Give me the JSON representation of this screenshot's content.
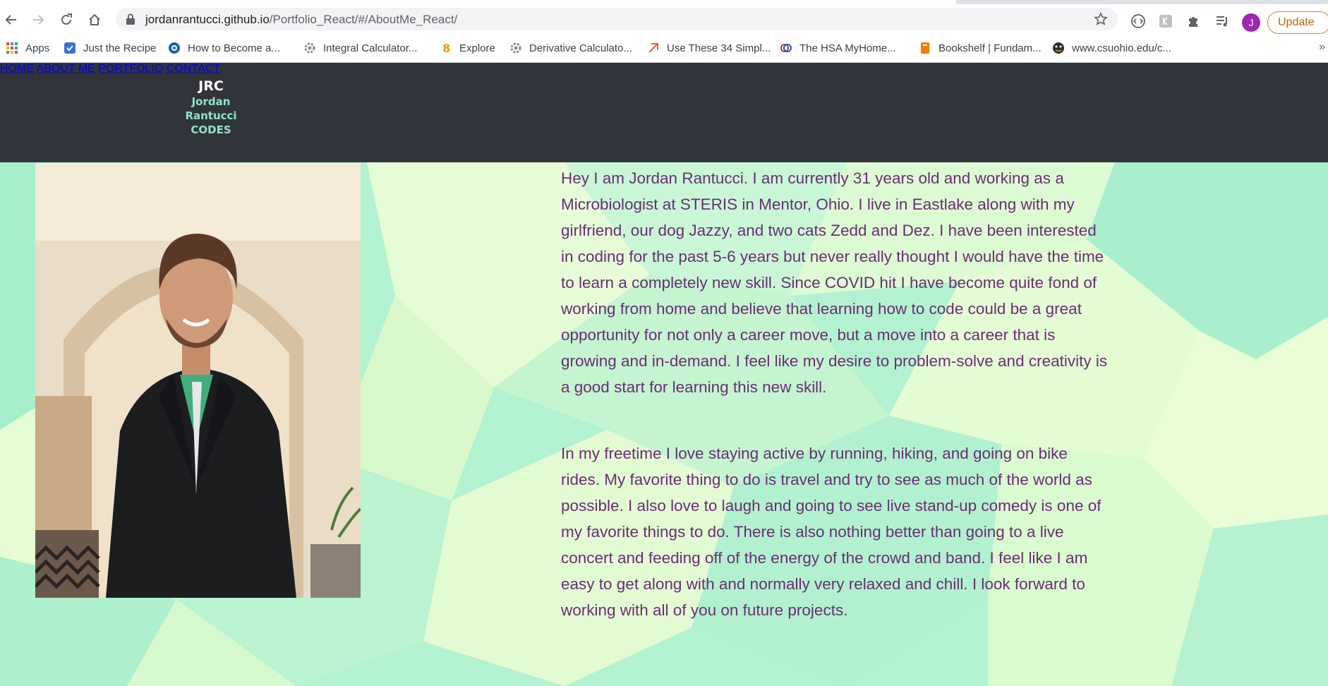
{
  "browser": {
    "url_host": "jordanrantucci.github.io",
    "url_path": "/Portfolio_React/#/AboutMe_React/",
    "profile_initial": "J",
    "update_label": "Update"
  },
  "bookmarks": [
    {
      "label": "Apps",
      "icon": "apps-grid-icon"
    },
    {
      "label": "Just the Recipe",
      "icon": "recipe-icon"
    },
    {
      "label": "How to Become a...",
      "icon": "globe-icon"
    },
    {
      "label": "Integral Calculator...",
      "icon": "gear-icon"
    },
    {
      "label": "Explore",
      "icon": "explore-icon"
    },
    {
      "label": "Derivative Calculato...",
      "icon": "gear-icon"
    },
    {
      "label": "Use These 34 Simpl...",
      "icon": "link-icon"
    },
    {
      "label": "The HSA MyHome...",
      "icon": "hsa-icon"
    },
    {
      "label": "Bookshelf | Fundam...",
      "icon": "bookshelf-icon"
    },
    {
      "label": "www.csuohio.edu/c...",
      "icon": "csu-icon"
    }
  ],
  "site": {
    "logo": {
      "line1": "JRC",
      "line2": "Jordan",
      "line3": "Rantucci",
      "line4": "CODES"
    },
    "nav": [
      "HOME",
      "ABOUT ME",
      "PORTFOLIO",
      "CONTACT"
    ],
    "colors": {
      "header_bg": "#31353b",
      "bio_text": "#6a2e74",
      "logo_accent": "#8fe3c5"
    },
    "bio": {
      "paragraph1": "Hey I am Jordan Rantucci. I am currently 31 years old and working as a Microbiologist at STERIS in Mentor, Ohio. I live in Eastlake along with my girlfriend, our dog Jazzy, and two cats Zedd and Dez. I have been interested in coding for the past 5-6 years but never really thought I would have the time to learn a completely new skill. Since COVID hit I have become quite fond of working from home and believe that learning how to code could be a great opportunity for not only a career move, but a move into a career that is growing and in-demand. I feel like my desire to problem-solve and creativity is a good start for learning this new skill.",
      "paragraph2": "In my freetime I love staying active by running, hiking, and going on bike rides. My favorite thing to do is travel and try to see as much of the world as possible. I also love to laugh and going to see live stand-up comedy is one of my favorite things to do. There is also nothing better than going to a live concert and feeding off of the energy of the crowd and band. I feel like I am easy to get along with and normally very relaxed and chill. I look forward to working with all of you on future projects."
    }
  }
}
